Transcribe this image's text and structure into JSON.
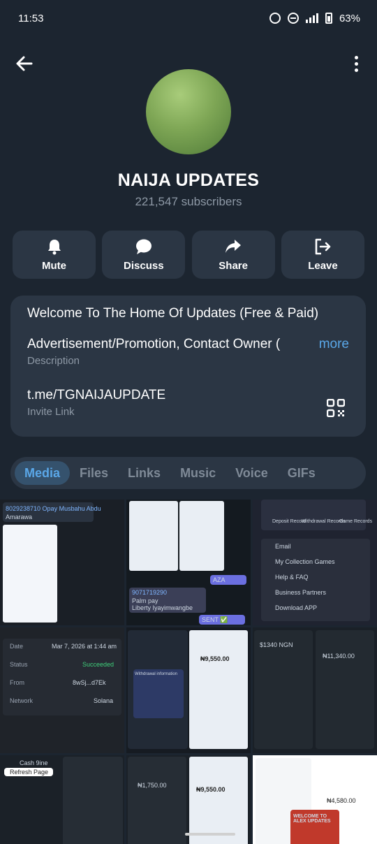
{
  "status_bar": {
    "time": "11:53",
    "battery": "63%",
    "network": "3G"
  },
  "header": {
    "back_icon": "arrow-left-icon",
    "menu_icon": "more-vertical-icon"
  },
  "channel": {
    "name": "NAIJA UPDATES",
    "subscribers": "221,547 subscribers",
    "avatar_color": "#7ea655"
  },
  "actions": [
    {
      "label": "Mute",
      "icon": "bell-icon"
    },
    {
      "label": "Discuss",
      "icon": "chat-bubble-icon"
    },
    {
      "label": "Share",
      "icon": "share-arrow-icon"
    },
    {
      "label": "Leave",
      "icon": "leave-icon"
    }
  ],
  "info": {
    "welcome": "Welcome To The Home Of Updates (Free & Paid)",
    "description": "Advertisement/Promotion, Contact Owner (",
    "more_label": "more",
    "description_label": "Description",
    "invite_link": "t.me/TGNAIJAUPDATE",
    "invite_label": "Invite Link"
  },
  "tabs": [
    {
      "label": "Media",
      "active": true
    },
    {
      "label": "Files"
    },
    {
      "label": "Links"
    },
    {
      "label": "Music"
    },
    {
      "label": "Voice"
    },
    {
      "label": "GIFs"
    }
  ],
  "media": {
    "thumb1": {
      "line1": "8029238710 Opay Musbahu Abdu",
      "line2": "Amarawa"
    },
    "thumb2": {
      "line1": "AZA",
      "line2": "9071719290",
      "line3": "Palm pay",
      "line4": "Liberty Iyayimwangbe",
      "line5": "SENT ✅"
    },
    "thumb3": {
      "line1": "Deposit Record",
      "line2": "Withdrawal Records",
      "line3": "Game Records",
      "line4": "Email",
      "line5": "My Collection Games",
      "line6": "Help & FAQ",
      "line7": "Business Partners",
      "line8": "Download APP"
    },
    "thumb4": {
      "date_label": "Date",
      "date": "Mar 7, 2026 at 1:44 am",
      "status_label": "Status",
      "status": "Succeeded",
      "from_label": "From",
      "from": "8wSj...d7Ek",
      "network_label": "Network",
      "network": "Solana"
    },
    "thumb5": {
      "amount1": "₦9,550.00",
      "amount2": "₦9,550.00",
      "label": "Withdrawal information"
    },
    "thumb6": {
      "amount1": "₦11,340.00",
      "amount2": "$1340 NGN"
    },
    "thumb7": {
      "label": "Cash 9ine",
      "sub": "Refresh Page"
    },
    "thumb8": {
      "amount": "₦1,750.00"
    },
    "thumb9": {
      "amount": "₦9,550.00"
    },
    "thumb10": {
      "amount": "₦4,580.00",
      "banner": "WELCOME TO ALEX UPDATES"
    }
  }
}
